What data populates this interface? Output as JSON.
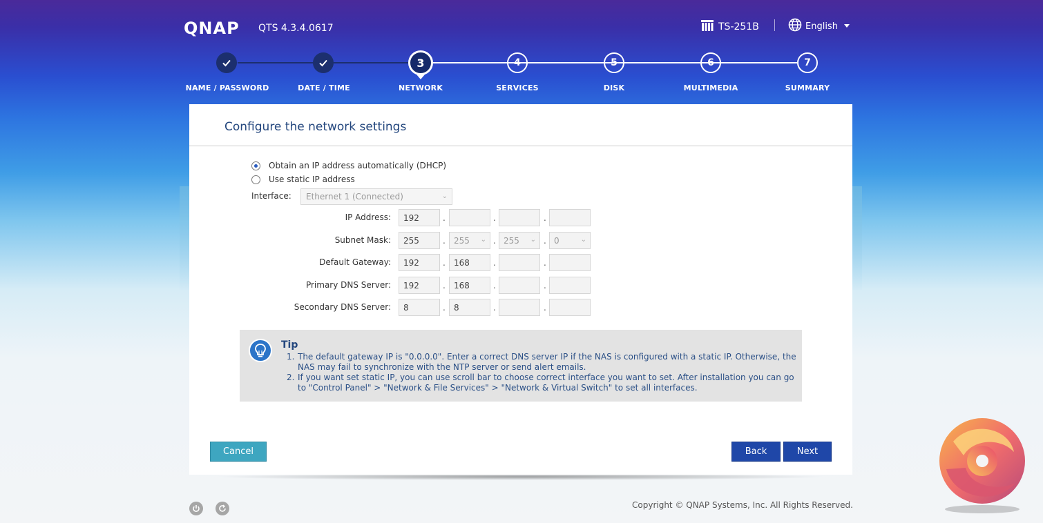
{
  "header": {
    "logo": "QNAP",
    "version": "QTS 4.3.4.0617",
    "model": "TS-251B",
    "language": "English"
  },
  "steps": [
    {
      "num": "✓",
      "label": "NAME / PASSWORD",
      "state": "done"
    },
    {
      "num": "✓",
      "label": "DATE / TIME",
      "state": "done"
    },
    {
      "num": "3",
      "label": "NETWORK",
      "state": "current"
    },
    {
      "num": "4",
      "label": "SERVICES",
      "state": "future"
    },
    {
      "num": "5",
      "label": "DISK",
      "state": "future"
    },
    {
      "num": "6",
      "label": "MULTIMEDIA",
      "state": "future"
    },
    {
      "num": "7",
      "label": "SUMMARY",
      "state": "future"
    }
  ],
  "panel": {
    "title": "Configure the network settings",
    "dhcp_label": "Obtain an IP address automatically (DHCP)",
    "static_label": "Use static IP address",
    "interface_label": "Interface:",
    "interface_value": "Ethernet 1 (Connected)",
    "fields": {
      "ip": {
        "label": "IP Address:",
        "octets": [
          "192",
          "",
          "",
          ""
        ]
      },
      "mask": {
        "label": "Subnet Mask:",
        "octets": [
          "255",
          "255",
          "255",
          "0"
        ]
      },
      "gateway": {
        "label": "Default Gateway:",
        "octets": [
          "192",
          "168",
          "",
          ""
        ]
      },
      "dns1": {
        "label": "Primary DNS Server:",
        "octets": [
          "192",
          "168",
          "",
          ""
        ]
      },
      "dns2": {
        "label": "Secondary DNS Server:",
        "octets": [
          "8",
          "8",
          "",
          ""
        ]
      }
    },
    "octet_separator": "."
  },
  "tip": {
    "title": "Tip",
    "items": [
      {
        "num": "1.",
        "text": "The default gateway IP is \"0.0.0.0\". Enter a correct DNS server IP if the NAS is configured with a static IP. Otherwise, the NAS may fail to synchronize with the NTP server or send alert emails."
      },
      {
        "num": "2.",
        "text": "If you want set static IP, you can use scroll bar to choose correct interface you want to set. After installation you can go to \"Control Panel\" > \"Network & File Services\" > \"Network & Virtual Switch\" to set all interfaces."
      }
    ]
  },
  "buttons": {
    "cancel": "Cancel",
    "back": "Back",
    "next": "Next"
  },
  "footer": {
    "copyright": "Copyright © QNAP Systems, Inc. All Rights Reserved."
  },
  "icons": {
    "check": "check-icon",
    "server": "server-icon",
    "globe": "globe-icon",
    "power": "power-icon",
    "restart": "restart-icon",
    "tip": "lightbulb-icon"
  }
}
